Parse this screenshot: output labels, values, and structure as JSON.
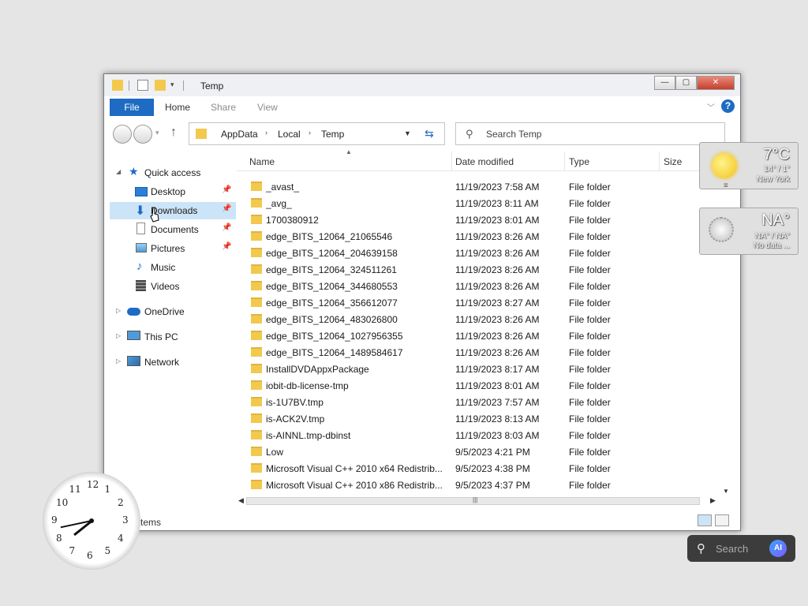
{
  "window": {
    "title": "Temp",
    "controls": {
      "minimize": "—",
      "maximize": "▢",
      "close": "✕"
    }
  },
  "ribbon": {
    "file": "File",
    "tabs": [
      "Home",
      "Share",
      "View"
    ],
    "help": "?"
  },
  "address": {
    "crumbs": [
      "AppData",
      "Local",
      "Temp"
    ],
    "separator": "›"
  },
  "search": {
    "placeholder": "Search Temp"
  },
  "navpane": {
    "quick_access": "Quick access",
    "items": [
      {
        "label": "Desktop",
        "icon": "desktop-icon",
        "pinned": true
      },
      {
        "label": "Downloads",
        "icon": "downloads-icon",
        "pinned": true,
        "selected": true
      },
      {
        "label": "Documents",
        "icon": "documents-icon",
        "pinned": true
      },
      {
        "label": "Pictures",
        "icon": "pictures-icon",
        "pinned": true
      },
      {
        "label": "Music",
        "icon": "music-icon",
        "pinned": false
      },
      {
        "label": "Videos",
        "icon": "videos-icon",
        "pinned": false
      }
    ],
    "onedrive": "OneDrive",
    "thispc": "This PC",
    "network": "Network"
  },
  "columns": {
    "name": "Name",
    "date": "Date modified",
    "type": "Type",
    "size": "Size"
  },
  "files": [
    {
      "name": "_avast_",
      "date": "11/19/2023 7:58 AM",
      "type": "File folder"
    },
    {
      "name": "_avg_",
      "date": "11/19/2023 8:11 AM",
      "type": "File folder"
    },
    {
      "name": "1700380912",
      "date": "11/19/2023 8:01 AM",
      "type": "File folder"
    },
    {
      "name": "edge_BITS_12064_21065546",
      "date": "11/19/2023 8:26 AM",
      "type": "File folder"
    },
    {
      "name": "edge_BITS_12064_204639158",
      "date": "11/19/2023 8:26 AM",
      "type": "File folder"
    },
    {
      "name": "edge_BITS_12064_324511261",
      "date": "11/19/2023 8:26 AM",
      "type": "File folder"
    },
    {
      "name": "edge_BITS_12064_344680553",
      "date": "11/19/2023 8:26 AM",
      "type": "File folder"
    },
    {
      "name": "edge_BITS_12064_356612077",
      "date": "11/19/2023 8:27 AM",
      "type": "File folder"
    },
    {
      "name": "edge_BITS_12064_483026800",
      "date": "11/19/2023 8:26 AM",
      "type": "File folder"
    },
    {
      "name": "edge_BITS_12064_1027956355",
      "date": "11/19/2023 8:26 AM",
      "type": "File folder"
    },
    {
      "name": "edge_BITS_12064_1489584617",
      "date": "11/19/2023 8:26 AM",
      "type": "File folder"
    },
    {
      "name": "InstallDVDAppxPackage",
      "date": "11/19/2023 8:17 AM",
      "type": "File folder"
    },
    {
      "name": "iobit-db-license-tmp",
      "date": "11/19/2023 8:01 AM",
      "type": "File folder"
    },
    {
      "name": "is-1U7BV.tmp",
      "date": "11/19/2023 7:57 AM",
      "type": "File folder"
    },
    {
      "name": "is-ACK2V.tmp",
      "date": "11/19/2023 8:13 AM",
      "type": "File folder"
    },
    {
      "name": "is-AINNL.tmp-dbinst",
      "date": "11/19/2023 8:03 AM",
      "type": "File folder"
    },
    {
      "name": "Low",
      "date": "9/5/2023 4:21 PM",
      "type": "File folder"
    },
    {
      "name": "Microsoft Visual C++ 2010  x64 Redistrib...",
      "date": "9/5/2023 4:38 PM",
      "type": "File folder"
    },
    {
      "name": "Microsoft Visual C++ 2010  x86 Redistrib...",
      "date": "9/5/2023 4:37 PM",
      "type": "File folder"
    }
  ],
  "status": {
    "count": "123 items"
  },
  "weather": [
    {
      "temp": "7°C",
      "range": "14° / 1°",
      "location": "New York",
      "icon": "sun-icon"
    },
    {
      "temp": "NA°",
      "range": "NA° / NA°",
      "location": "No data ...",
      "icon": "gear-weather-icon"
    }
  ],
  "clock": {
    "numbers": [
      "12",
      "1",
      "2",
      "3",
      "4",
      "5",
      "6",
      "7",
      "8",
      "9",
      "10",
      "11"
    ],
    "hour": 7,
    "minute": 43
  },
  "taskbar": {
    "search_label": "Search",
    "ai_label": "AI"
  }
}
